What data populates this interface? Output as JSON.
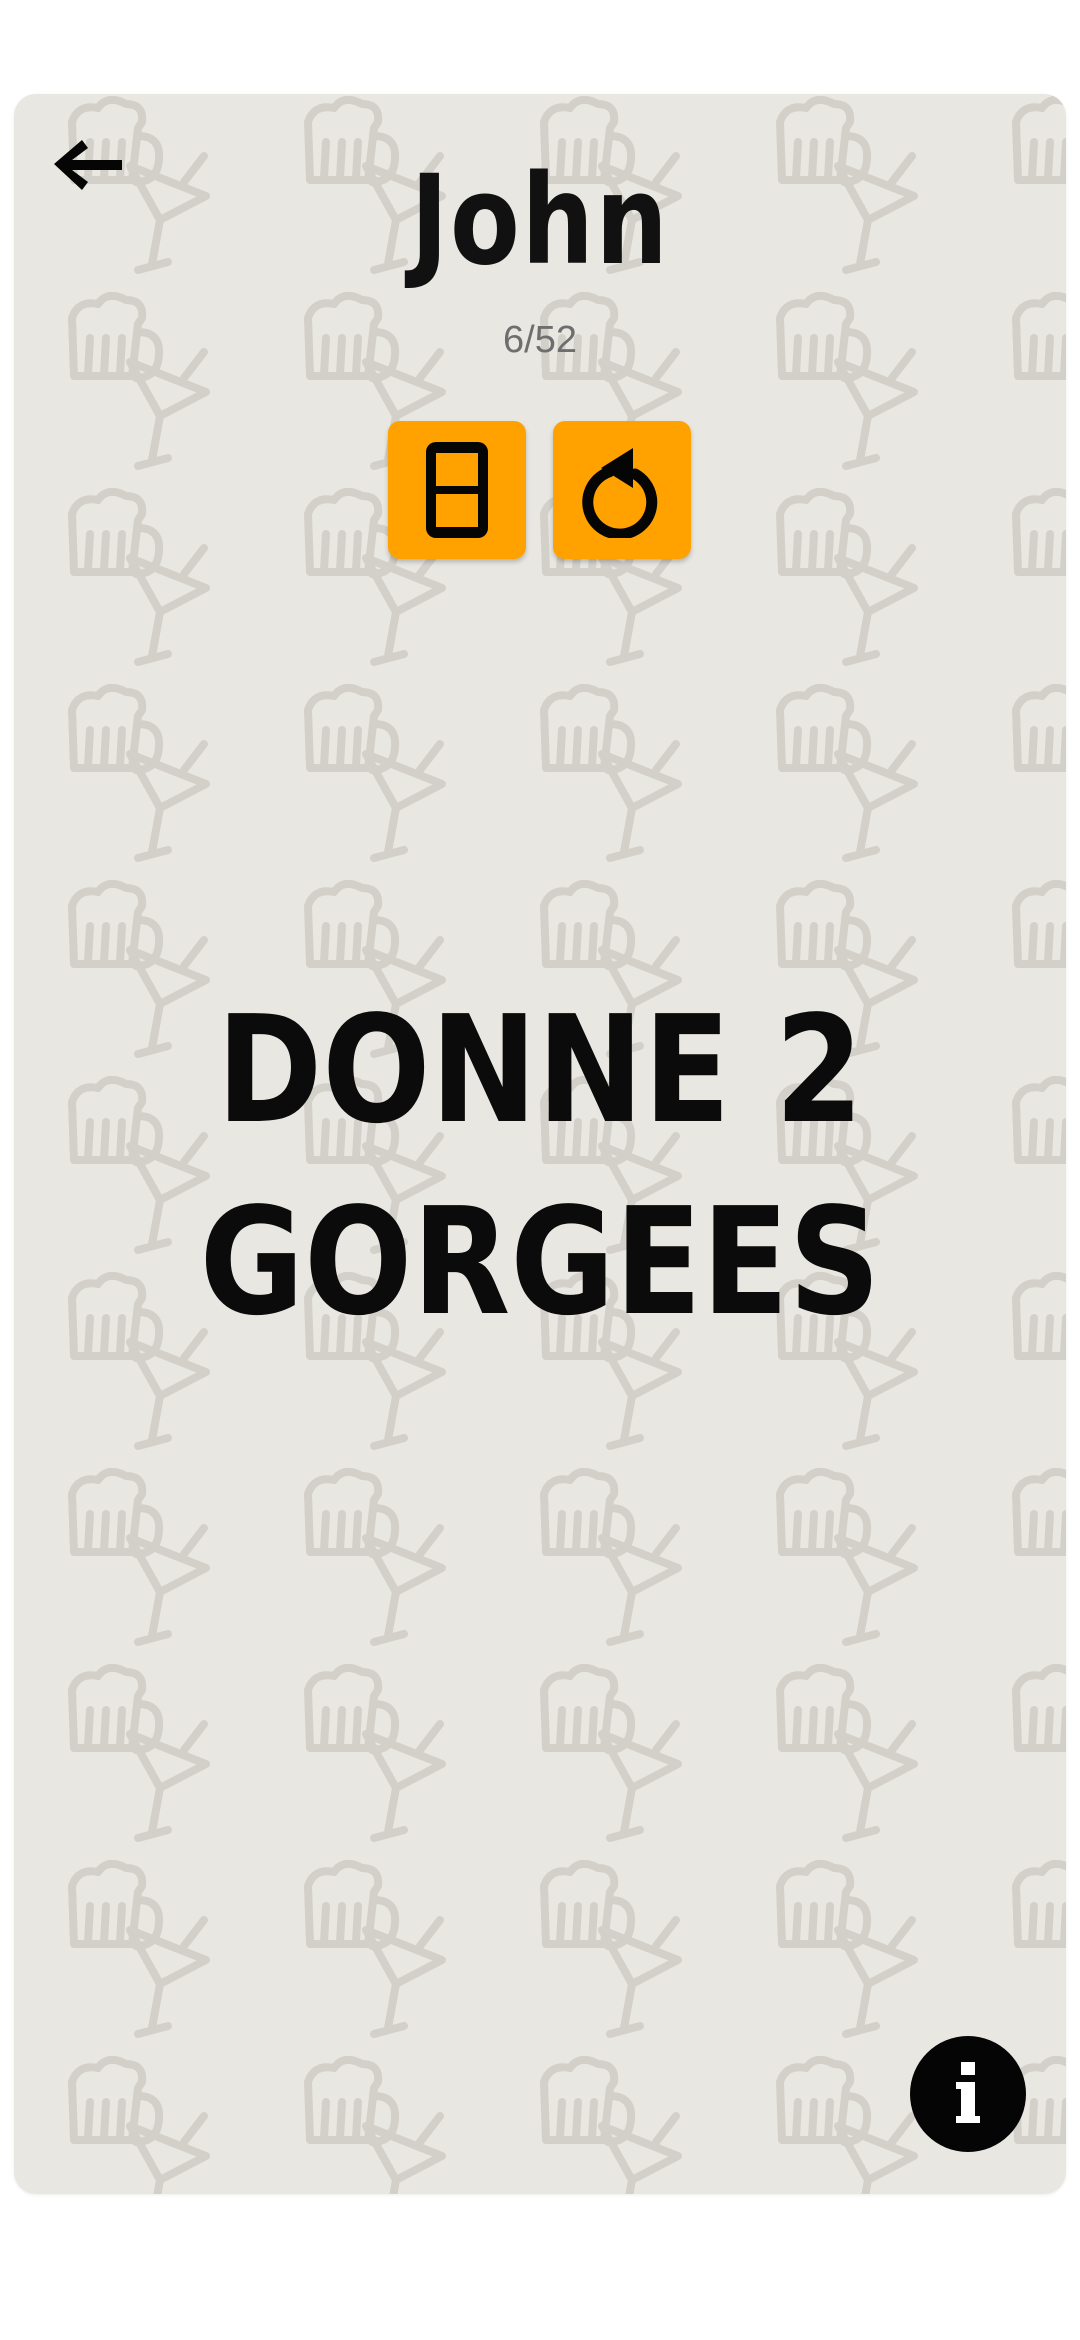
{
  "player": {
    "name": "John"
  },
  "progress": {
    "counter": "6/52",
    "current": 6,
    "total": 52
  },
  "card": {
    "line1": "DONNE 2",
    "line2": "GORGEES"
  },
  "toolbar": {
    "back_icon": "arrow-left-icon",
    "card_icon": "card-icon",
    "reset_icon": "rotate-ccw-icon",
    "info_icon": "info-icon"
  },
  "colors": {
    "accent": "#ffa200",
    "background": "#e9e7e2",
    "text": "#0b0b0b",
    "counter": "#6e6e6e"
  }
}
